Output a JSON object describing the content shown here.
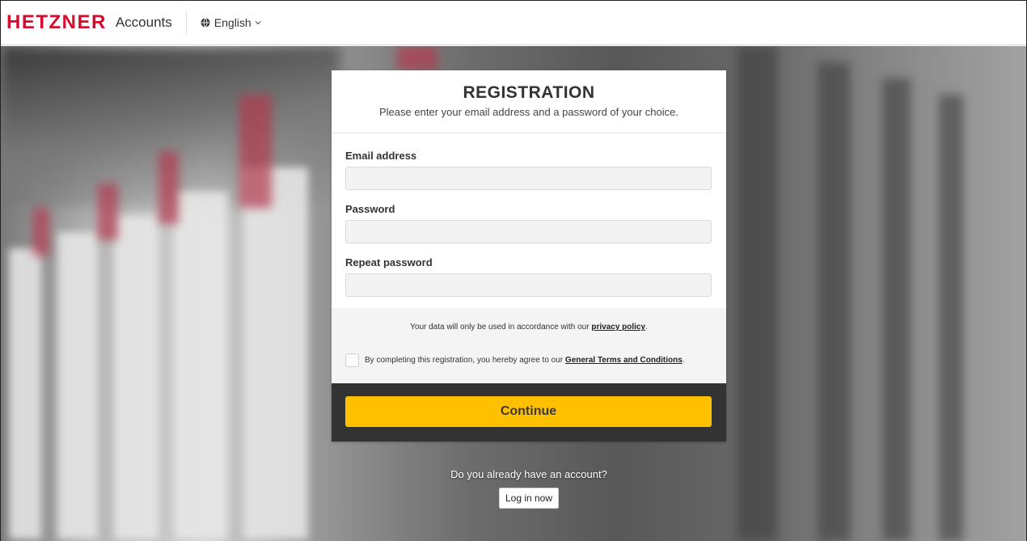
{
  "header": {
    "logo_text": "HETZNER",
    "product": "Accounts",
    "language": "English"
  },
  "card": {
    "title": "REGISTRATION",
    "subtitle": "Please enter your email address and a password of your choice.",
    "fields": [
      {
        "label": "Email address",
        "value": "",
        "placeholder": ""
      },
      {
        "label": "Password",
        "value": "",
        "placeholder": ""
      },
      {
        "label": "Repeat password",
        "value": "",
        "placeholder": ""
      }
    ],
    "privacy_prefix": "Your data will only be used in accordance with our ",
    "privacy_link": "privacy policy",
    "privacy_suffix": ".",
    "terms_prefix": "By completing this registration, you hereby agree to our ",
    "terms_link": "General Terms and Conditions",
    "terms_suffix": ".",
    "terms_checked": false,
    "continue_label": "Continue"
  },
  "login": {
    "question": "Do you already have an account?",
    "button_label": "Log in now"
  },
  "colors": {
    "brand_red": "#d50c2d",
    "accent_yellow": "#ffc000",
    "action_bar": "#333333"
  },
  "icons": {
    "language": "globe-icon",
    "language_toggle": "chevron-down-icon"
  }
}
